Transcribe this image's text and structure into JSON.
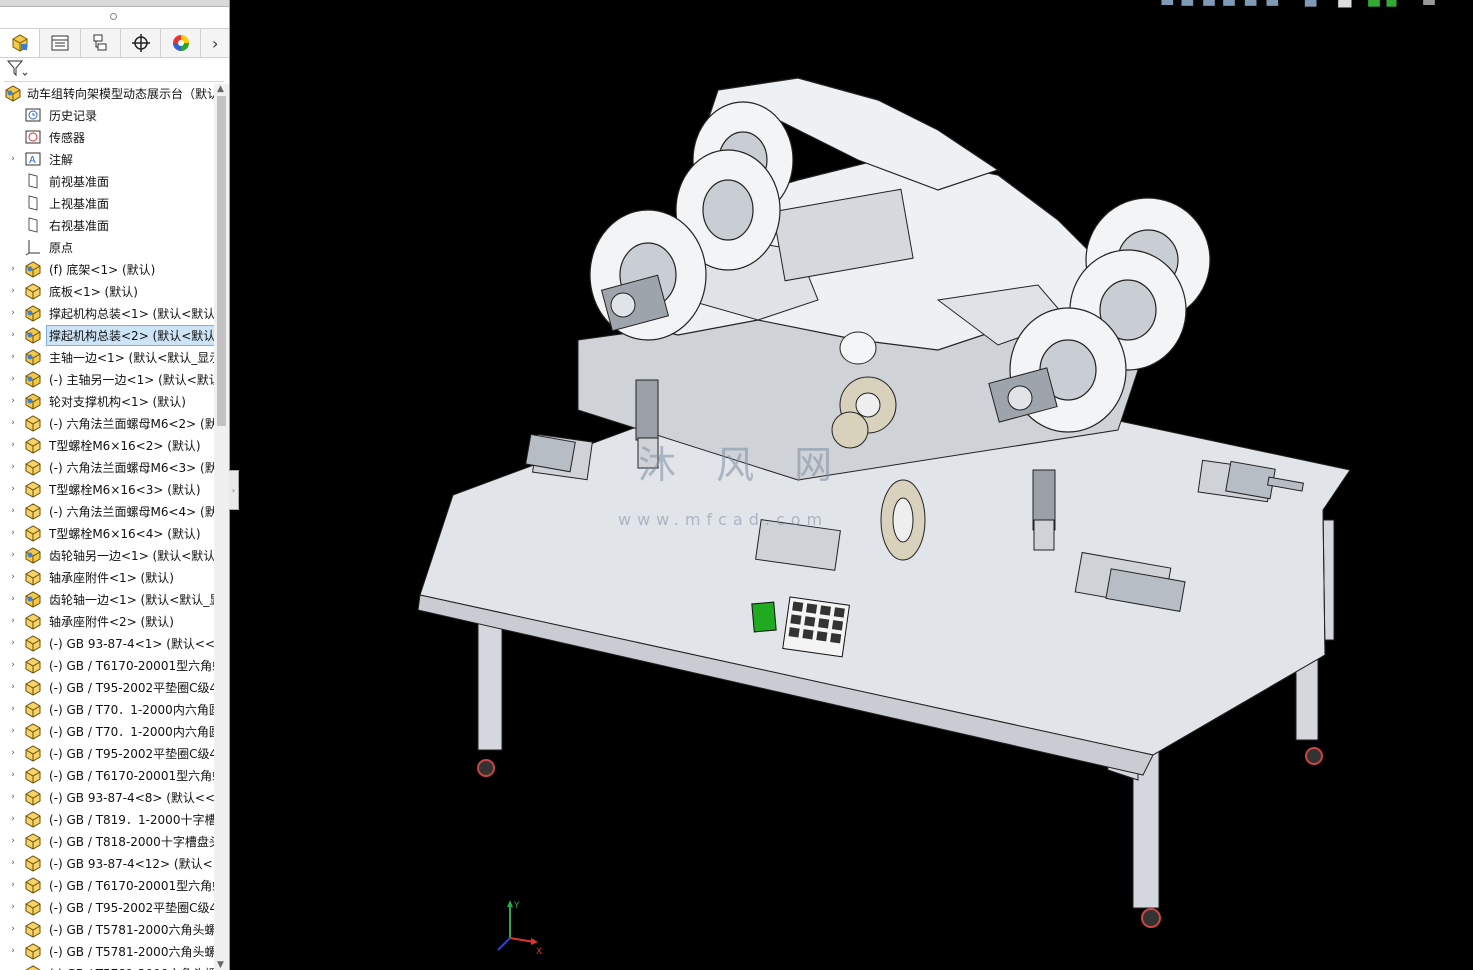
{
  "sidebar": {
    "tabs": [
      {
        "icon": "part-cube-icon"
      },
      {
        "icon": "property-list-icon"
      },
      {
        "icon": "configuration-icon"
      },
      {
        "icon": "crosshair-icon"
      },
      {
        "icon": "appearance-color-icon"
      }
    ],
    "more_tabs_glyph": "›",
    "filter_icon": "funnel-filter-icon",
    "tree": [
      {
        "label": "动车组转向架模型动态展示台（默认",
        "icon": "assembly-icon",
        "expander": "",
        "level": 0
      },
      {
        "label": "历史记录",
        "icon": "history-icon",
        "expander": "",
        "level": 1
      },
      {
        "label": "传感器",
        "icon": "sensor-icon",
        "expander": "",
        "level": 1
      },
      {
        "label": "注解",
        "icon": "annotation-icon",
        "expander": "›",
        "level": 1
      },
      {
        "label": "前视基准面",
        "icon": "plane-icon",
        "expander": "",
        "level": 1
      },
      {
        "label": "上视基准面",
        "icon": "plane-icon",
        "expander": "",
        "level": 1
      },
      {
        "label": "右视基准面",
        "icon": "plane-icon",
        "expander": "",
        "level": 1
      },
      {
        "label": "原点",
        "icon": "origin-icon",
        "expander": "",
        "level": 1
      },
      {
        "label": "(f) 底架<1> (默认)",
        "icon": "subassembly-icon",
        "expander": "›",
        "level": 1
      },
      {
        "label": "底板<1> (默认)",
        "icon": "part-icon",
        "expander": "›",
        "level": 1
      },
      {
        "label": "撑起机构总装<1> (默认<默认",
        "icon": "subassembly-icon",
        "expander": "›",
        "level": 1
      },
      {
        "label": "撑起机构总装<2> (默认<默认",
        "icon": "subassembly-icon",
        "expander": "›",
        "level": 1,
        "selected": true
      },
      {
        "label": "主轴一边<1> (默认<默认_显示",
        "icon": "subassembly-icon",
        "expander": "›",
        "level": 1
      },
      {
        "label": "(-) 主轴另一边<1> (默认<默认",
        "icon": "subassembly-icon",
        "expander": "›",
        "level": 1
      },
      {
        "label": "轮对支撑机构<1> (默认)",
        "icon": "subassembly-icon",
        "expander": "›",
        "level": 1
      },
      {
        "label": "(-) 六角法兰面螺母M6<2> (默",
        "icon": "part-icon",
        "expander": "›",
        "level": 1
      },
      {
        "label": "T型螺栓M6×16<2> (默认)",
        "icon": "part-icon",
        "expander": "›",
        "level": 1
      },
      {
        "label": "(-) 六角法兰面螺母M6<3> (默",
        "icon": "part-icon",
        "expander": "›",
        "level": 1
      },
      {
        "label": "T型螺栓M6×16<3> (默认)",
        "icon": "part-icon",
        "expander": "›",
        "level": 1
      },
      {
        "label": "(-) 六角法兰面螺母M6<4> (默",
        "icon": "part-icon",
        "expander": "›",
        "level": 1
      },
      {
        "label": "T型螺栓M6×16<4> (默认)",
        "icon": "part-icon",
        "expander": "›",
        "level": 1
      },
      {
        "label": "齿轮轴另一边<1> (默认<默认",
        "icon": "subassembly-icon",
        "expander": "›",
        "level": 1
      },
      {
        "label": "轴承座附件<1> (默认)",
        "icon": "part-icon",
        "expander": "›",
        "level": 1
      },
      {
        "label": "齿轮轴一边<1> (默认<默认_显",
        "icon": "subassembly-icon",
        "expander": "›",
        "level": 1
      },
      {
        "label": "轴承座附件<2> (默认)",
        "icon": "part-icon",
        "expander": "›",
        "level": 1
      },
      {
        "label": "(-) GB 93-87-4<1> (默认<<默",
        "icon": "part-icon",
        "expander": "›",
        "level": 1
      },
      {
        "label": "(-) GB / T6170-20001型六角螺",
        "icon": "part-icon",
        "expander": "›",
        "level": 1
      },
      {
        "label": "(-) GB / T95-2002平垫圈C级4",
        "icon": "part-icon",
        "expander": "›",
        "level": 1
      },
      {
        "label": "(-) GB / T70．1-2000内六角圆",
        "icon": "part-icon",
        "expander": "›",
        "level": 1
      },
      {
        "label": "(-) GB / T70．1-2000内六角圆",
        "icon": "part-icon",
        "expander": "›",
        "level": 1
      },
      {
        "label": "(-) GB / T95-2002平垫圈C级4",
        "icon": "part-icon",
        "expander": "›",
        "level": 1
      },
      {
        "label": "(-) GB / T6170-20001型六角螺",
        "icon": "part-icon",
        "expander": "›",
        "level": 1
      },
      {
        "label": "(-) GB 93-87-4<8> (默认<<默",
        "icon": "part-icon",
        "expander": "›",
        "level": 1
      },
      {
        "label": "(-) GB / T819．1-2000十字槽",
        "icon": "part-icon",
        "expander": "›",
        "level": 1
      },
      {
        "label": "(-) GB / T818-2000十字槽盘头",
        "icon": "part-icon",
        "expander": "›",
        "level": 1
      },
      {
        "label": "(-) GB 93-87-4<12> (默认<<",
        "icon": "part-icon",
        "expander": "›",
        "level": 1
      },
      {
        "label": "(-) GB / T6170-20001型六角螺",
        "icon": "part-icon",
        "expander": "›",
        "level": 1
      },
      {
        "label": "(-) GB / T95-2002平垫圈C级4",
        "icon": "part-icon",
        "expander": "›",
        "level": 1
      },
      {
        "label": "(-) GB / T5781-2000六角头螺",
        "icon": "part-icon",
        "expander": "›",
        "level": 1
      },
      {
        "label": "(-) GB / T5781-2000六角头螺",
        "icon": "part-icon",
        "expander": "›",
        "level": 1
      },
      {
        "label": "(-) GB / T5781-2000六角头螺",
        "icon": "part-icon",
        "expander": "›",
        "level": 1
      }
    ]
  },
  "viewport": {
    "background": "#000000",
    "model_color": "#e8ecf0",
    "watermark": "沐 风 网",
    "watermark_url": "www.mfcad.com",
    "triad_axes": {
      "x": "X",
      "y": "Y"
    }
  },
  "colors": {
    "selection": "#cde4f7",
    "assembly_icon": "#e6b830",
    "button_green": "#1faa1f"
  }
}
